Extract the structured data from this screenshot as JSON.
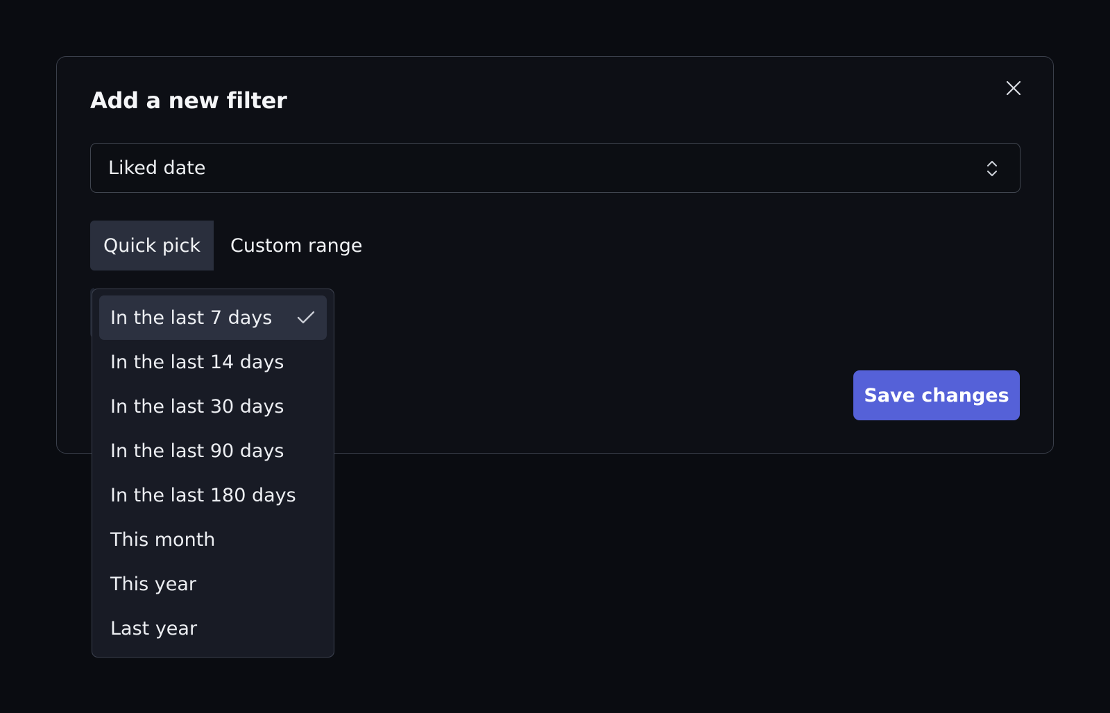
{
  "modal": {
    "title": "Add a new filter",
    "field_select": {
      "value": "Liked date"
    },
    "tabs": [
      {
        "label": "Quick pick",
        "active": true
      },
      {
        "label": "Custom range",
        "active": false
      }
    ],
    "save_label": "Save changes"
  },
  "dropdown": {
    "selected_index": 0,
    "options": [
      {
        "label": "In the last 7 days"
      },
      {
        "label": "In the last 14 days"
      },
      {
        "label": "In the last 30 days"
      },
      {
        "label": "In the last 90 days"
      },
      {
        "label": "In the last 180 days"
      },
      {
        "label": "This month"
      },
      {
        "label": "This year"
      },
      {
        "label": "Last year"
      }
    ]
  },
  "icons": {
    "close": "close-icon",
    "select": "chevron-up-down-icon",
    "selected": "check-icon"
  },
  "colors": {
    "background": "#0a0c11",
    "modal_border": "#3a3f4b",
    "active_tab": "#2a2f3d",
    "dropdown_bg": "#181b25",
    "selected_option": "#2c3140",
    "accent": "#5561d8"
  }
}
